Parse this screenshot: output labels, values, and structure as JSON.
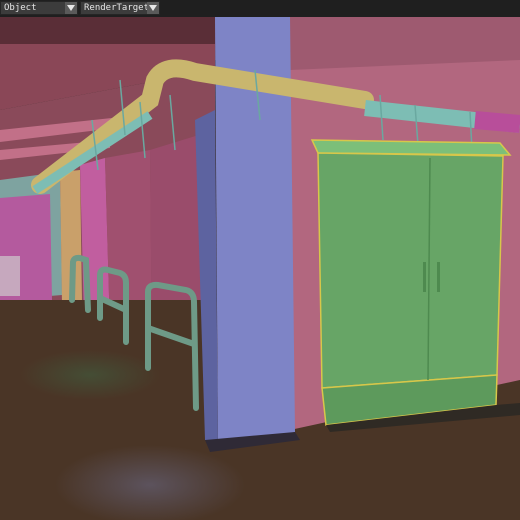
{
  "toolbar": {
    "object_dropdown": {
      "value": "Object",
      "icon": "triangle-down-icon"
    },
    "render_dropdown": {
      "value": "RenderTargets",
      "icon": "triangle-down-icon"
    }
  },
  "viewport": {
    "scene": "false-color render target view of an underground corridor with pipes, column, railings and a green electrical cabinet",
    "colors": {
      "background": "#3a2e2a",
      "toolbar": "#1f1f1f",
      "floor": "#4a3526",
      "right_wall": "#b2677f",
      "column": "#7e84c6",
      "cabinet": "#67a566",
      "cabinet_outline": "#d7c74a",
      "pipe_yellow": "#c9b66e",
      "pipe_cyan": "#7dbdb4",
      "railing": "#6e9a87"
    }
  }
}
